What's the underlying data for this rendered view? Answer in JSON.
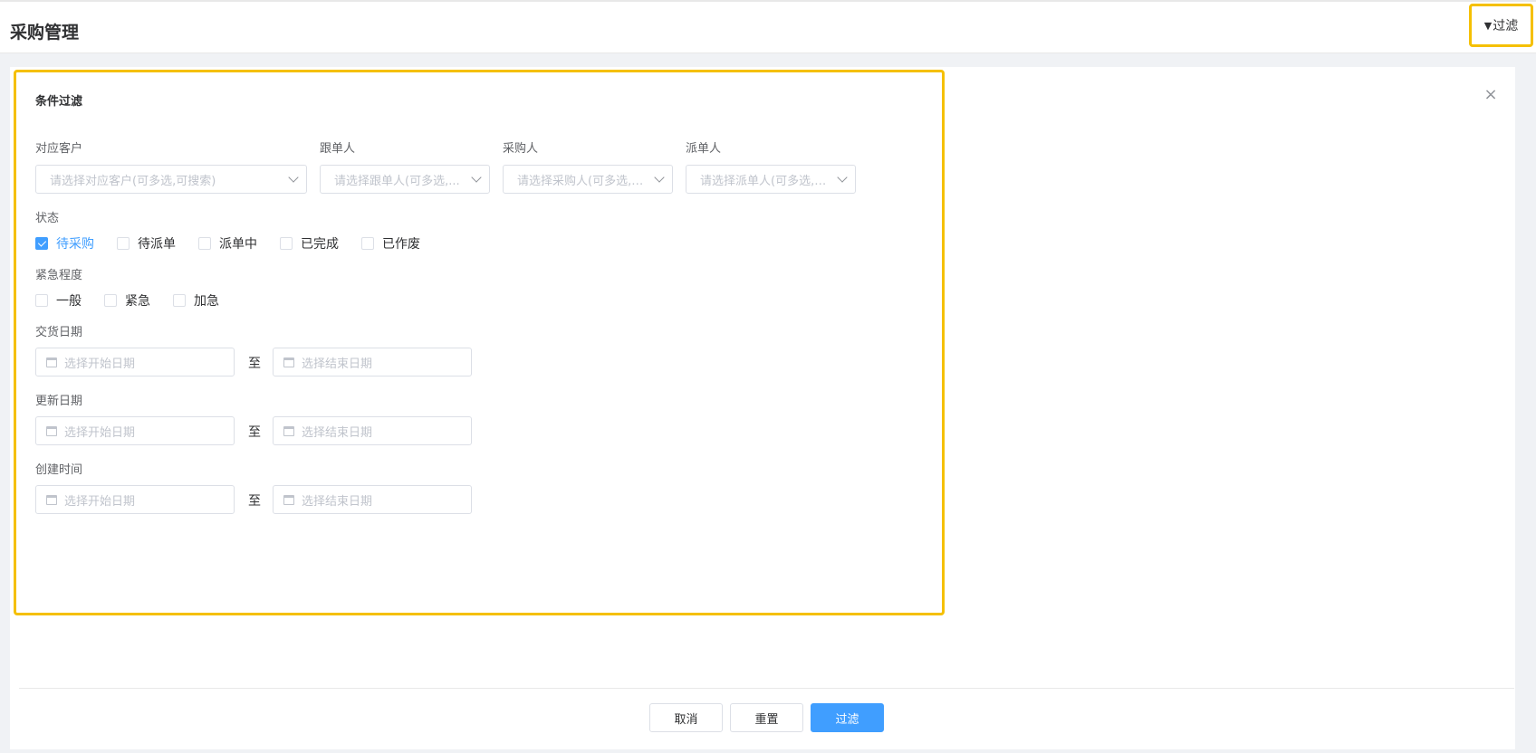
{
  "header": {
    "title": "采购管理",
    "filter_label": "过滤"
  },
  "panel": {
    "title": "条件过滤"
  },
  "filters": {
    "customer": {
      "label": "对应客户",
      "placeholder": "请选择对应客户(可多选,可搜索)"
    },
    "follower": {
      "label": "跟单人",
      "placeholder": "请选择跟单人(可多选,..."
    },
    "purchaser": {
      "label": "采购人",
      "placeholder": "请选择采购人(可多选,可..."
    },
    "dispatcher": {
      "label": "派单人",
      "placeholder": "请选择派单人(可多选,可..."
    },
    "status": {
      "label": "状态",
      "options": [
        {
          "label": "待采购",
          "checked": true
        },
        {
          "label": "待派单",
          "checked": false
        },
        {
          "label": "派单中",
          "checked": false
        },
        {
          "label": "已完成",
          "checked": false
        },
        {
          "label": "已作废",
          "checked": false
        }
      ]
    },
    "urgency": {
      "label": "紧急程度",
      "options": [
        {
          "label": "一般",
          "checked": false
        },
        {
          "label": "紧急",
          "checked": false
        },
        {
          "label": "加急",
          "checked": false
        }
      ]
    },
    "delivery_date": {
      "label": "交货日期",
      "start_placeholder": "选择开始日期",
      "separator": "至",
      "end_placeholder": "选择结束日期"
    },
    "update_date": {
      "label": "更新日期",
      "start_placeholder": "选择开始日期",
      "separator": "至",
      "end_placeholder": "选择结束日期"
    },
    "create_time": {
      "label": "创建时间",
      "start_placeholder": "选择开始日期",
      "separator": "至",
      "end_placeholder": "选择结束日期"
    }
  },
  "footer": {
    "cancel_label": "取消",
    "reset_label": "重置",
    "filter_label": "过滤"
  },
  "colors": {
    "accent": "#409eff",
    "highlight": "#f5c000"
  }
}
